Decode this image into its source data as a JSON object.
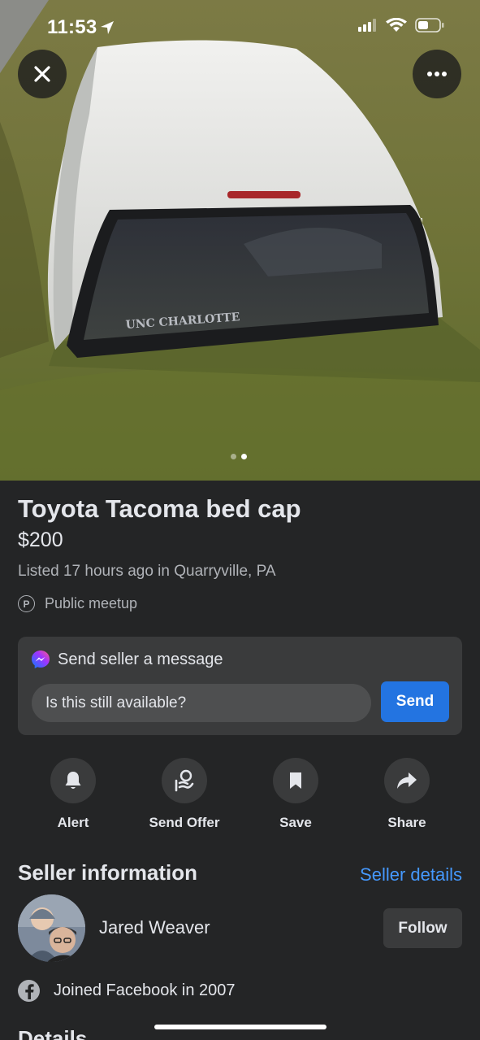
{
  "status_bar": {
    "time": "11:53"
  },
  "photo": {
    "decal_text": "UNC CHARLOTTE",
    "page_count": 2,
    "active_page": 2
  },
  "listing": {
    "title": "Toyota Tacoma bed cap",
    "price": "$200",
    "listed": "Listed 17 hours ago in Quarryville, PA",
    "meetup_icon": "P",
    "meetup": "Public meetup"
  },
  "message": {
    "header": "Send seller a message",
    "input_value": "Is this still available?",
    "send_label": "Send"
  },
  "actions": [
    {
      "label": "Alert",
      "icon": "bell-icon"
    },
    {
      "label": "Send Offer",
      "icon": "offer-icon"
    },
    {
      "label": "Save",
      "icon": "bookmark-icon"
    },
    {
      "label": "Share",
      "icon": "share-icon"
    }
  ],
  "seller": {
    "heading": "Seller information",
    "details_link": "Seller details",
    "name": "Jared Weaver",
    "follow_label": "Follow",
    "joined": "Joined Facebook in 2007"
  },
  "details": {
    "heading": "Details"
  },
  "colors": {
    "background": "#242526",
    "card": "#3a3b3c",
    "accent": "#2374e1",
    "link": "#4599ff"
  }
}
